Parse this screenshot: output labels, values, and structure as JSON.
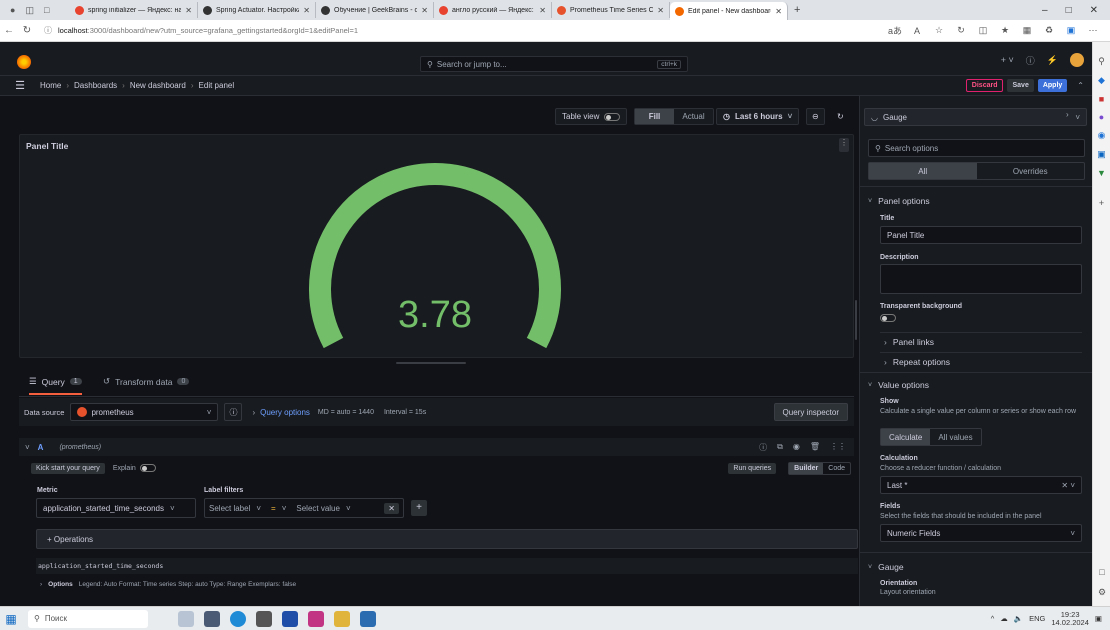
{
  "browser": {
    "tabs": [
      {
        "label": "spring initializer — Яндекс: нашл",
        "color": "#e8432e"
      },
      {
        "label": "Spring Actuator. Настройка мон",
        "color": "#333333"
      },
      {
        "label": "Обучение | GeekBrains - образо",
        "color": "#333333"
      },
      {
        "label": "англо русский — Яндекс: нашл",
        "color": "#e8432e"
      },
      {
        "label": "Prometheus Time Series Collect",
        "color": "#e6522c"
      },
      {
        "label": "Edit panel - New dashboard - Da",
        "color": "#f46800"
      }
    ],
    "url_host": "localhost",
    "url_rest": ":3000/dashboard/new?utm_source=grafana_gettingstarted&orgId=1&editPanel=1"
  },
  "grafana": {
    "search_placeholder": "Search or jump to...",
    "search_shortcut": "ctrl+k",
    "breadcrumb": [
      "Home",
      "Dashboards",
      "New dashboard",
      "Edit panel"
    ],
    "discard": "Discard",
    "save": "Save",
    "apply": "Apply",
    "table_view": "Table view",
    "fill": "Fill",
    "actual": "Actual",
    "time_range": "Last 6 hours",
    "panel_title": "Panel Title",
    "gauge_value": "3.78",
    "gauge_fraction": 1.0,
    "gauge_color": "#73bf69",
    "query_tab": "Query",
    "query_count": "1",
    "transform_tab": "Transform data",
    "transform_count": "0",
    "data_source_label": "Data source",
    "data_source": "prometheus",
    "query_options": "Query options",
    "query_meta_md": "MD = auto = 1440",
    "query_meta_interval": "Interval = 15s",
    "query_inspector": "Query inspector",
    "query_ref": "A",
    "query_ds": "(prometheus)",
    "kick_start": "Kick start your query",
    "explain": "Explain",
    "run_queries": "Run queries",
    "builder": "Builder",
    "code": "Code",
    "metric_label": "Metric",
    "label_filters": "Label filters",
    "metric_value": "application_started_time_seconds",
    "select_label": "Select label",
    "operator": "=",
    "select_value": "Select value",
    "operations": "+ Operations",
    "query_text": "application_started_time_seconds",
    "options_label": "Options",
    "options_summary": "Legend: Auto   Format: Time series   Step: auto   Type: Range   Exemplars: false"
  },
  "sidebar": {
    "viz": "Gauge",
    "search_placeholder": "Search options",
    "all": "All",
    "overrides": "Overrides",
    "panel_options": "Panel options",
    "title_label": "Title",
    "title_value": "Panel Title",
    "description_label": "Description",
    "transparent_label": "Transparent background",
    "panel_links": "Panel links",
    "repeat_options": "Repeat options",
    "value_options": "Value options",
    "show_label": "Show",
    "show_desc": "Calculate a single value per column or series or show each row",
    "calculate": "Calculate",
    "all_values": "All values",
    "calculation_label": "Calculation",
    "calculation_desc": "Choose a reducer function / calculation",
    "calculation_value": "Last *",
    "fields_label": "Fields",
    "fields_desc": "Select the fields that should be included in the panel",
    "fields_value": "Numeric Fields",
    "gauge_section": "Gauge",
    "orientation_label": "Orientation",
    "orientation_desc": "Layout orientation"
  },
  "taskbar": {
    "search": "Поиск",
    "lang": "ENG",
    "time": "19:23",
    "date": "14.02.2024"
  }
}
